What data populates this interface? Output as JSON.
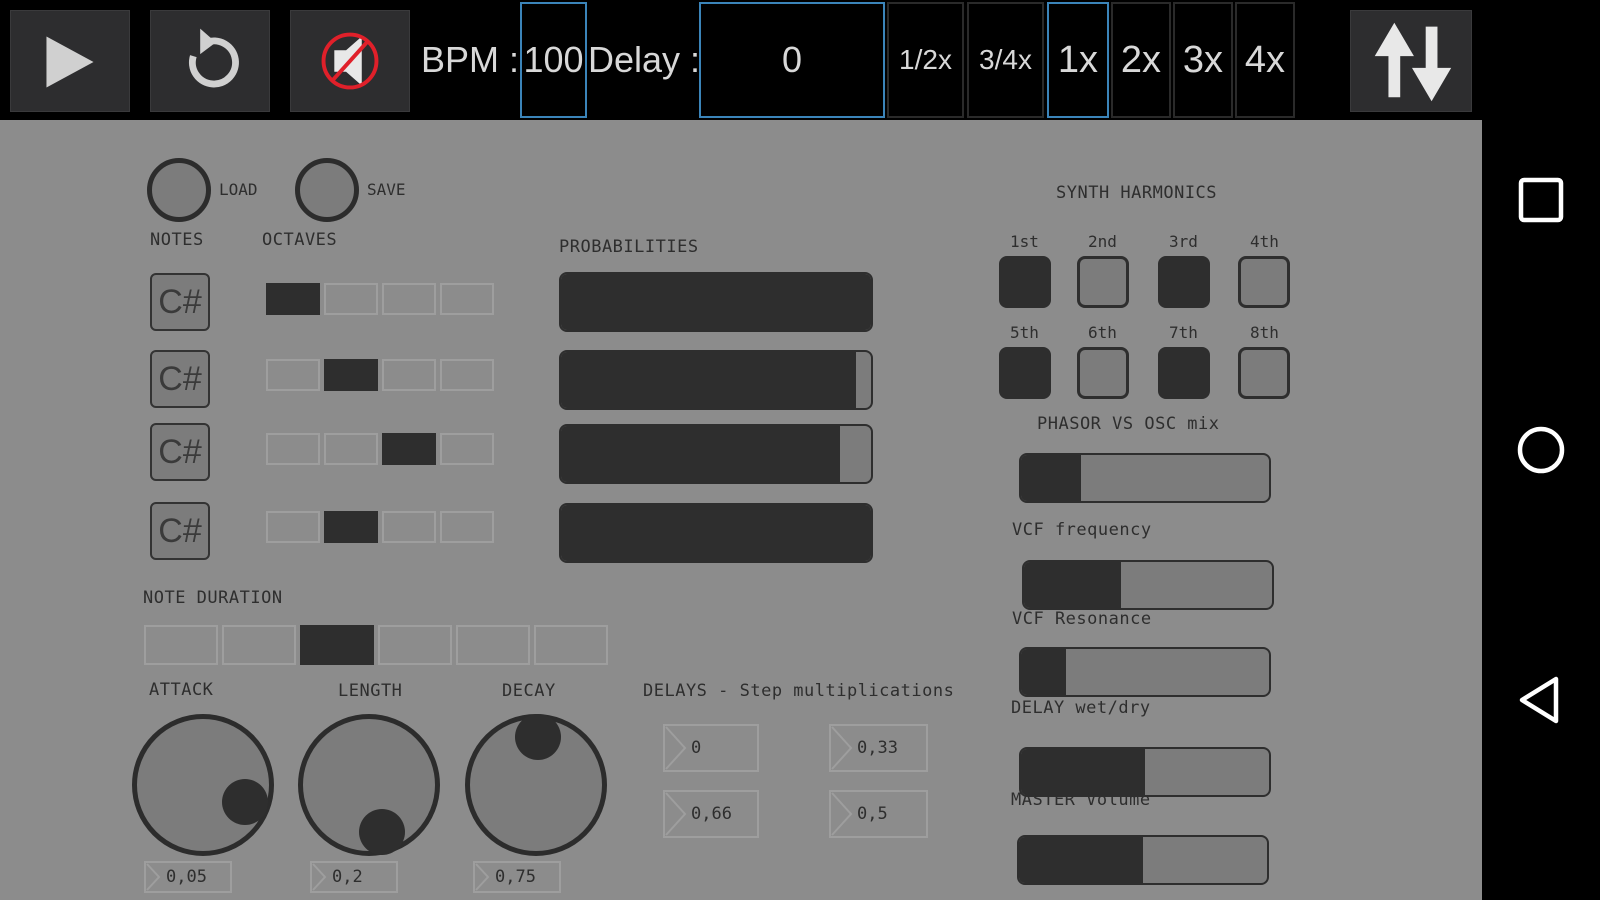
{
  "toolbar": {
    "bpm_label": "BPM :",
    "bpm_value": "100",
    "delay_label": "Delay :",
    "delay_value": "0",
    "multipliers": [
      "1/2x",
      "3/4x",
      "1x",
      "2x",
      "3x",
      "4x"
    ],
    "selected_multiplier": "1x"
  },
  "files": {
    "load_label": "LOAD",
    "save_label": "SAVE"
  },
  "sequencer": {
    "notes_label": "NOTES",
    "octaves_label": "OCTAVES",
    "probabilities_label": "PROBABILITIES",
    "rows": [
      {
        "note": "C#",
        "octave_active": 1,
        "probability": 1.0
      },
      {
        "note": "C#",
        "octave_active": 2,
        "probability": 0.95
      },
      {
        "note": "C#",
        "octave_active": 3,
        "probability": 0.9
      },
      {
        "note": "C#",
        "octave_active": 2,
        "probability": 1.0
      }
    ]
  },
  "duration": {
    "label": "NOTE DURATION",
    "active_index": 3,
    "count": 6
  },
  "envelope": {
    "attack_label": "ATTACK",
    "attack_value": "0,05",
    "length_label": "LENGTH",
    "length_value": "0,2",
    "decay_label": "DECAY",
    "decay_value": "0,75"
  },
  "delays": {
    "label": "DELAYS - Step multiplications",
    "values": [
      "0",
      "0,33",
      "0,66",
      "0,5"
    ]
  },
  "synth": {
    "harmonics_label": "SYNTH HARMONICS",
    "harmonics": [
      {
        "label": "1st",
        "on": true
      },
      {
        "label": "2nd",
        "on": false
      },
      {
        "label": "3rd",
        "on": true
      },
      {
        "label": "4th",
        "on": false
      },
      {
        "label": "5th",
        "on": true
      },
      {
        "label": "6th",
        "on": false
      },
      {
        "label": "7th",
        "on": true
      },
      {
        "label": "8th",
        "on": false
      }
    ],
    "phasor_label": "PHASOR VS OSC mix",
    "phasor_value": 0.24,
    "vcf_freq_label": "VCF frequency",
    "vcf_freq_value": 0.39,
    "vcf_res_label": "VCF Resonance",
    "vcf_res_value": 0.18,
    "delay_wet_label": "DELAY wet/dry",
    "delay_wet_value": 0.5,
    "master_label": "MASTER Volume",
    "master_value": 0.5
  },
  "colors": {
    "panel": "#8c8c8c",
    "dark": "#2e2e2e",
    "accent": "#3b84b9",
    "mute": "#e0202a"
  }
}
